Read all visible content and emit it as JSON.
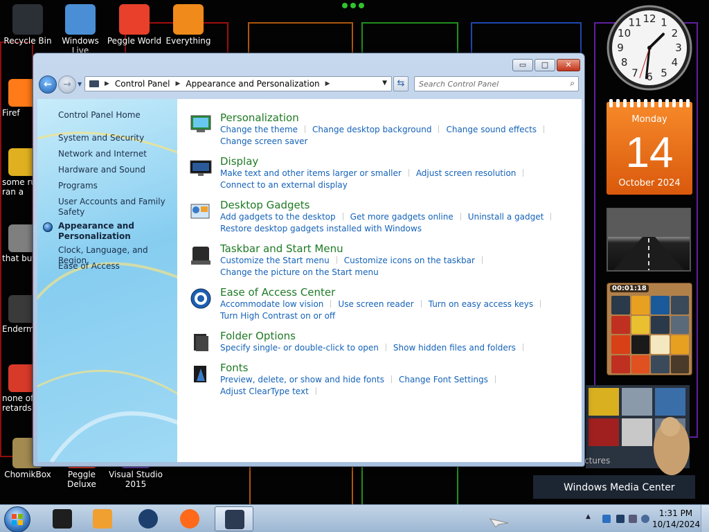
{
  "desktop": {
    "icons_top": [
      {
        "name": "recycle-bin",
        "label": "Recycle Bin",
        "color": "#2b2f36"
      },
      {
        "name": "windows-live",
        "label": "Windows Live",
        "color": "#4a8fd6"
      },
      {
        "name": "peggle-world",
        "label": "Peggle World",
        "color": "#e8402a"
      },
      {
        "name": "everything",
        "label": "Everything",
        "color": "#f08a1a"
      }
    ],
    "icons_left": [
      {
        "name": "firefox",
        "label": "Firef",
        "color": "#ff7a18"
      },
      {
        "name": "some-ru",
        "label": "some ru",
        "label2": "ran a",
        "color": "#e0b020"
      },
      {
        "name": "that-but",
        "label": "that but",
        "color": "#7f7f7f"
      },
      {
        "name": "enderm",
        "label": "Enderm",
        "color": "#3a3a3a"
      },
      {
        "name": "none-of",
        "label": "none of",
        "label2": "retards l",
        "color": "#d83a2a"
      }
    ],
    "icons_bottom": [
      {
        "name": "chomikbox",
        "label": "ChomikBox",
        "color": "#a28a50"
      },
      {
        "name": "peggle-deluxe",
        "label": "Peggle Deluxe",
        "color": "#e8402a"
      },
      {
        "name": "visual-studio",
        "label": "Visual Studio",
        "label2": "2015",
        "color": "#6a3fa8"
      }
    ]
  },
  "window": {
    "caption": {
      "minimize": "▭",
      "maximize": "□",
      "close": "✕"
    },
    "breadcrumb": [
      "Control Panel",
      "Appearance and Personalization"
    ],
    "search_placeholder": "Search Control Panel",
    "sidebar": {
      "home": "Control Panel Home",
      "items": [
        {
          "label": "System and Security"
        },
        {
          "label": "Network and Internet"
        },
        {
          "label": "Hardware and Sound"
        },
        {
          "label": "Programs"
        },
        {
          "label": "User Accounts and Family",
          "label2": "Safety"
        },
        {
          "label": "Appearance and",
          "label2": "Personalization",
          "current": true
        },
        {
          "label": "Clock, Language, and Region"
        },
        {
          "label": "Ease of Access"
        }
      ]
    },
    "categories": [
      {
        "name": "personalization",
        "title": "Personalization",
        "icon": "personalization-icon",
        "links": [
          "Change the theme",
          "Change desktop background",
          "Change sound effects"
        ],
        "links2": [
          "Change screen saver"
        ]
      },
      {
        "name": "display",
        "title": "Display",
        "icon": "display-icon",
        "links": [
          "Make text and other items larger or smaller",
          "Adjust screen resolution"
        ],
        "links2": [
          "Connect to an external display"
        ]
      },
      {
        "name": "desktop-gadgets",
        "title": "Desktop Gadgets",
        "icon": "gadgets-icon",
        "links": [
          "Add gadgets to the desktop",
          "Get more gadgets online",
          "Uninstall a gadget"
        ],
        "links2": [
          "Restore desktop gadgets installed with Windows"
        ]
      },
      {
        "name": "taskbar-start-menu",
        "title": "Taskbar and Start Menu",
        "icon": "taskbar-icon",
        "links": [
          "Customize the Start menu",
          "Customize icons on the taskbar"
        ],
        "links2": [
          "Change the picture on the Start menu"
        ]
      },
      {
        "name": "ease-of-access-center",
        "title": "Ease of Access Center",
        "icon": "ease-of-access-icon",
        "links": [
          "Accommodate low vision",
          "Use screen reader",
          "Turn on easy access keys"
        ],
        "links2": [
          "Turn High Contrast on or off"
        ]
      },
      {
        "name": "folder-options",
        "title": "Folder Options",
        "icon": "folder-options-icon",
        "links": [
          "Specify single- or double-click to open",
          "Show hidden files and folders"
        ],
        "links2": []
      },
      {
        "name": "fonts",
        "title": "Fonts",
        "icon": "fonts-icon",
        "links": [
          "Preview, delete, or show and hide fonts",
          "Change Font Settings",
          "Adjust ClearType text"
        ],
        "links2": []
      }
    ]
  },
  "gadgets": {
    "clock": {
      "hour": 1,
      "minute": 31,
      "second": 33
    },
    "calendar": {
      "weekday": "Monday",
      "day": "14",
      "month_year": "October 2024"
    },
    "puzzle_timer": "00:01:18",
    "media_center": {
      "label": "Windows Media Center",
      "sublabel": "ctures"
    }
  },
  "taskbar": {
    "time": "1:31 PM",
    "date": "10/14/2024",
    "apps": [
      {
        "name": "taskbar-app-1",
        "color": "#1e1e1e"
      },
      {
        "name": "taskbar-media-player",
        "color": "#f0a030"
      },
      {
        "name": "taskbar-globe",
        "color": "#1c3f6e"
      },
      {
        "name": "taskbar-firefox",
        "color": "#ff6a1a"
      },
      {
        "name": "taskbar-control-panel",
        "color": "#2c3a52",
        "active": true
      }
    ]
  }
}
